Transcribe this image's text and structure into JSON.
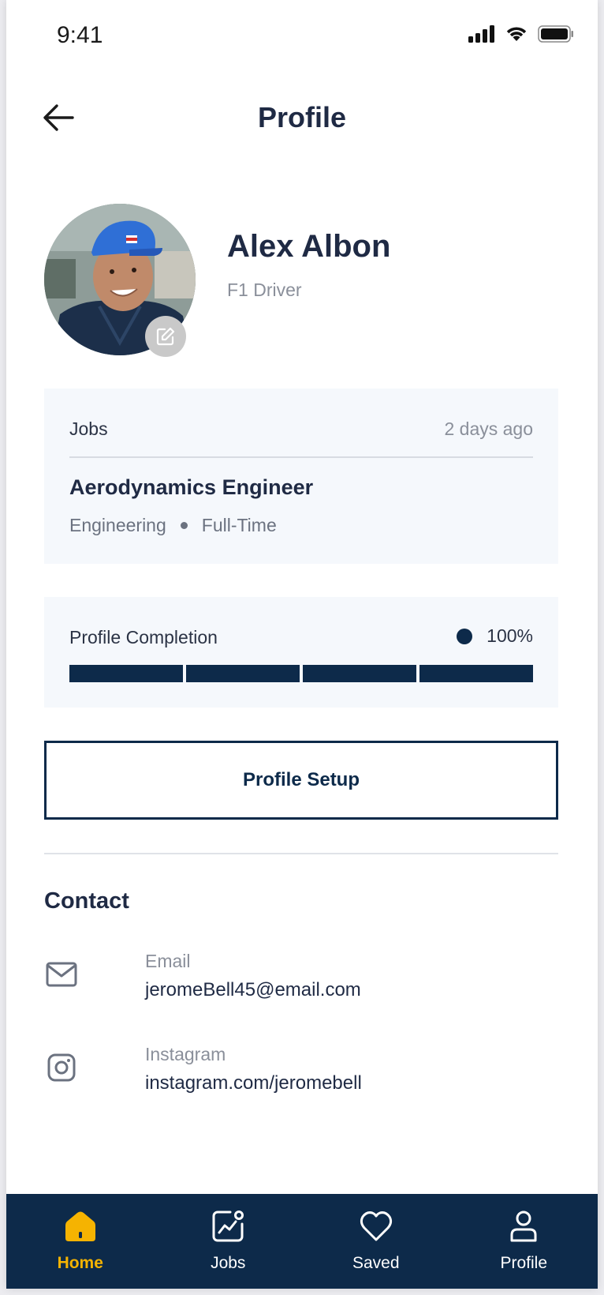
{
  "status_bar": {
    "time": "9:41"
  },
  "header": {
    "title": "Profile"
  },
  "profile": {
    "name": "Alex Albon",
    "role": "F1 Driver"
  },
  "jobs_card": {
    "label": "Jobs",
    "time": "2 days ago",
    "job_title": "Aerodynamics Engineer",
    "department": "Engineering",
    "employment_type": "Full-Time"
  },
  "completion": {
    "label": "Profile Completion",
    "value_text": "100%",
    "fraction": 1.0,
    "segments": 4
  },
  "setup_button": {
    "label": "Profile Setup"
  },
  "contact": {
    "title": "Contact",
    "email": {
      "label": "Email",
      "value": "jeromeBell45@email.com",
      "icon": "mail-icon"
    },
    "instagram": {
      "label": "Instagram",
      "value": "instagram.com/jeromebell",
      "icon": "instagram-icon"
    }
  },
  "bottom_nav": {
    "items": [
      {
        "label": "Home",
        "icon": "home-icon",
        "active": true
      },
      {
        "label": "Jobs",
        "icon": "jobs-chart-icon",
        "active": false
      },
      {
        "label": "Saved",
        "icon": "heart-icon",
        "active": false
      },
      {
        "label": "Profile",
        "icon": "user-icon",
        "active": false
      }
    ]
  },
  "colors": {
    "primary": "#0d2a4a",
    "accent": "#f5b301",
    "card_bg": "#f5f8fc",
    "muted_text": "#8a8f9a"
  }
}
